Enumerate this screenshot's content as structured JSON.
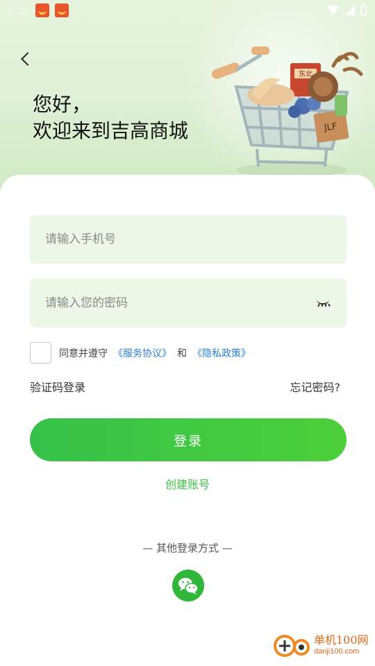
{
  "status_bar": {
    "time": "2:15"
  },
  "header": {
    "greeting_line1": "您好，",
    "greeting_line2": "欢迎来到吉高商城",
    "illustration_box_text": "东北",
    "illustration_crate_text": "JLF"
  },
  "form": {
    "phone_placeholder": "请输入手机号",
    "password_placeholder": "请输入您的密码",
    "agree_text": "同意并遵守",
    "service_agreement": "《服务协议》",
    "and_text": "和",
    "privacy_policy": "《隐私政策》",
    "code_login": "验证码登录",
    "forgot_password": "忘记密码?",
    "login_button": "登录",
    "create_account": "创建账号",
    "other_login": "— 其他登录方式 —"
  },
  "watermark": {
    "title": "单机100网",
    "url": "danji100.com"
  },
  "colors": {
    "accent_green": "#3cbf46",
    "link_blue": "#2a7fd4",
    "field_bg": "#ecf7e7"
  }
}
